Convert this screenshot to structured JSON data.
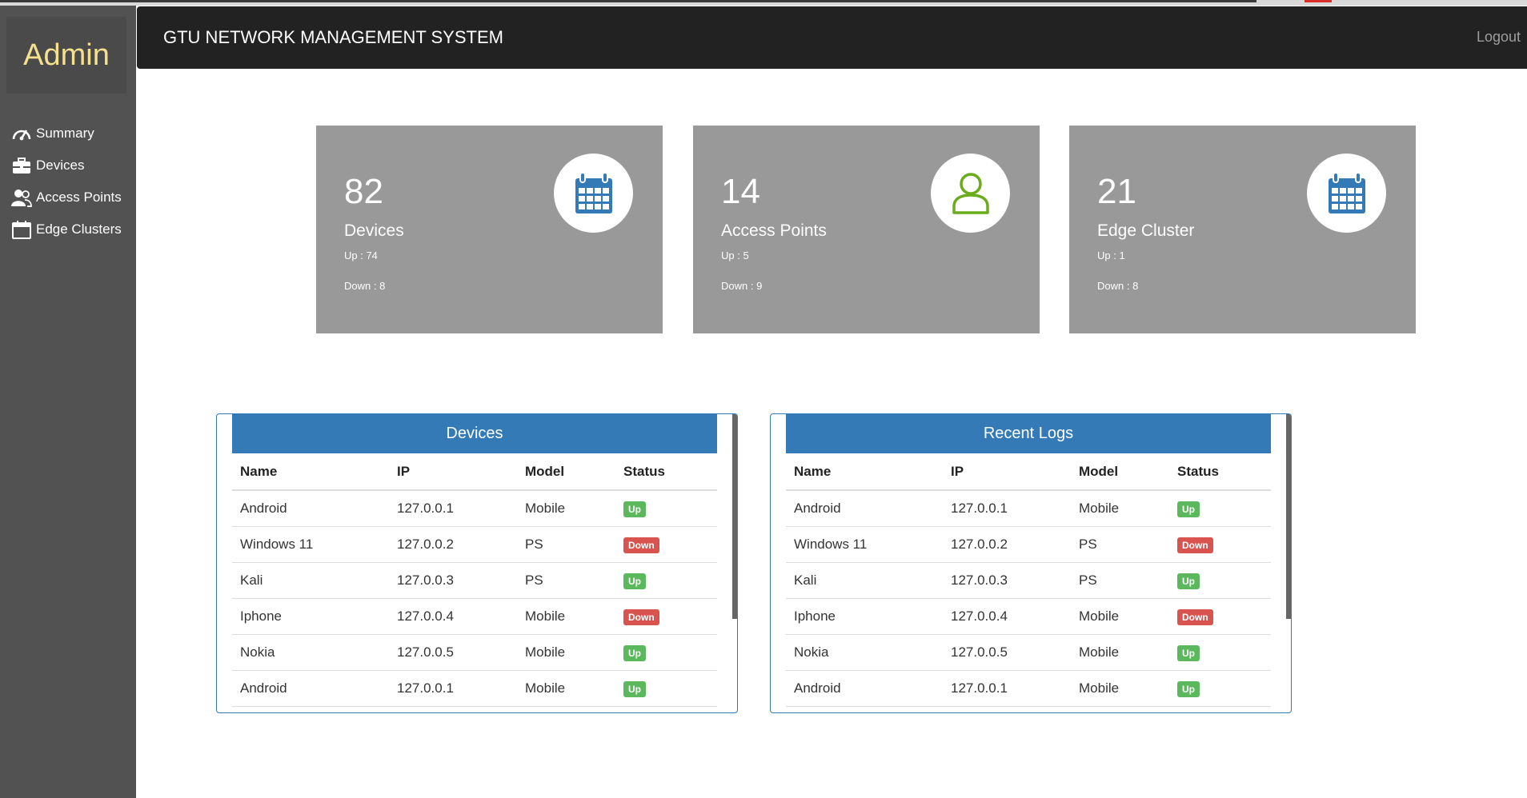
{
  "sidebar": {
    "brand": "Admin",
    "items": [
      {
        "label": "Summary",
        "icon": "dashboard-icon"
      },
      {
        "label": "Devices",
        "icon": "briefcase-icon"
      },
      {
        "label": "Access Points",
        "icon": "users-icon"
      },
      {
        "label": "Edge Clusters",
        "icon": "calendar-icon"
      }
    ]
  },
  "header": {
    "title": "GTU NETWORK MANAGEMENT SYSTEM",
    "logout": "Logout"
  },
  "cards": [
    {
      "count": "82",
      "label": "Devices",
      "up": "Up : 74",
      "down": "Down : 8",
      "icon": "calendar-icon",
      "icon_color": "#337ab7"
    },
    {
      "count": "14",
      "label": "Access Points",
      "up": "Up : 5",
      "down": "Down : 9",
      "icon": "user-icon",
      "icon_color": "#6aac1c"
    },
    {
      "count": "21",
      "label": "Edge Cluster",
      "up": "Up : 1",
      "down": "Down : 8",
      "icon": "calendar-icon",
      "icon_color": "#337ab7"
    }
  ],
  "panels": [
    {
      "title": "Devices",
      "columns": [
        "Name",
        "IP",
        "Model",
        "Status"
      ],
      "rows": [
        {
          "name": "Android",
          "ip": "127.0.0.1",
          "model": "Mobile",
          "status": "Up"
        },
        {
          "name": "Windows 11",
          "ip": "127.0.0.2",
          "model": "PS",
          "status": "Down"
        },
        {
          "name": "Kali",
          "ip": "127.0.0.3",
          "model": "PS",
          "status": "Up"
        },
        {
          "name": "Iphone",
          "ip": "127.0.0.4",
          "model": "Mobile",
          "status": "Down"
        },
        {
          "name": "Nokia",
          "ip": "127.0.0.5",
          "model": "Mobile",
          "status": "Up"
        },
        {
          "name": "Android",
          "ip": "127.0.0.1",
          "model": "Mobile",
          "status": "Up"
        }
      ]
    },
    {
      "title": "Recent Logs",
      "columns": [
        "Name",
        "IP",
        "Model",
        "Status"
      ],
      "rows": [
        {
          "name": "Android",
          "ip": "127.0.0.1",
          "model": "Mobile",
          "status": "Up"
        },
        {
          "name": "Windows 11",
          "ip": "127.0.0.2",
          "model": "PS",
          "status": "Down"
        },
        {
          "name": "Kali",
          "ip": "127.0.0.3",
          "model": "PS",
          "status": "Up"
        },
        {
          "name": "Iphone",
          "ip": "127.0.0.4",
          "model": "Mobile",
          "status": "Down"
        },
        {
          "name": "Nokia",
          "ip": "127.0.0.5",
          "model": "Mobile",
          "status": "Up"
        },
        {
          "name": "Android",
          "ip": "127.0.0.1",
          "model": "Mobile",
          "status": "Up"
        }
      ]
    }
  ],
  "colors": {
    "sidebar": "#525252",
    "brand_text": "#f5e08f",
    "header": "#222222",
    "card": "#999999",
    "panel_accent": "#337ab7",
    "status_up": "#5cb85c",
    "status_down": "#d9534f"
  }
}
